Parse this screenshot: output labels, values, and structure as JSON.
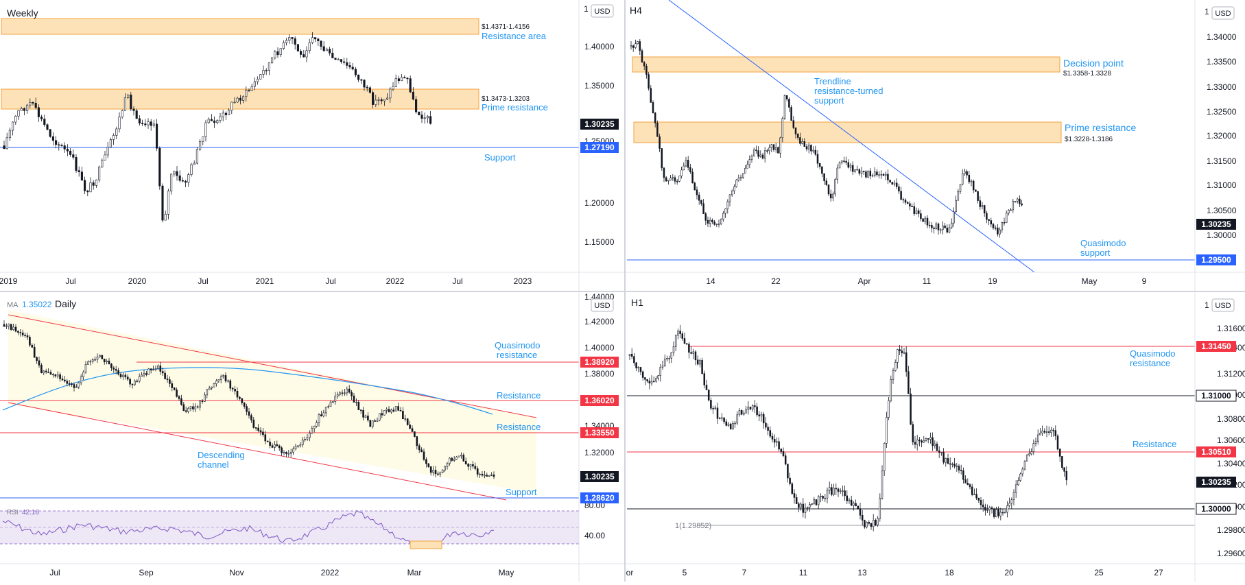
{
  "colors": {
    "zone_fill": "#fde2b8",
    "zone_stroke": "#f3a23c",
    "blue": "#2962ff",
    "blue_text": "#2196f3",
    "red": "#f23645",
    "black": "#131722",
    "grid_text": "#131722",
    "channel_fill": "#fefbe7",
    "ma_line": "#2196f3",
    "rsi_line": "#7e57c2",
    "rsi_fill": "#ede7f6"
  },
  "icons": {
    "currency_badge": "currency-badge-icon"
  },
  "panels": [
    {
      "id": "weekly",
      "title": "Weekly",
      "currency": "USD",
      "x_labels": [
        "2019",
        "Jul",
        "2020",
        "Jul",
        "2021",
        "Jul",
        "2022",
        "Jul",
        "2023"
      ],
      "y_labels": [
        "1.40000",
        "1.35000",
        "1.25000",
        "1.20000",
        "1.15000"
      ],
      "y_top_clipped": "1",
      "badges": [
        {
          "text": "1.30235",
          "style": "black"
        },
        {
          "text": "1.27190",
          "style": "blue"
        }
      ],
      "zones": [
        {
          "range": "$1.4371-1.4156",
          "label": "Resistance area"
        },
        {
          "range": "$1.3473-1.3203",
          "label": "Prime resistance"
        }
      ],
      "level_labels": [
        {
          "text": "Support"
        }
      ]
    },
    {
      "id": "h4",
      "title": "H4",
      "currency": "USD",
      "x_labels": [
        "14",
        "22",
        "Apr",
        "11",
        "19",
        "May",
        "9"
      ],
      "y_labels": [
        "1.34000",
        "1.33500",
        "1.33000",
        "1.32500",
        "1.32000",
        "1.31500",
        "1.31000",
        "1.30500",
        "1.30000"
      ],
      "y_top_clipped": "1",
      "badges": [
        {
          "text": "1.30235",
          "style": "black"
        },
        {
          "text": "1.29500",
          "style": "blue"
        }
      ],
      "zones": [
        {
          "range": "$1.3358-1.3328",
          "label": "Decision point"
        },
        {
          "range": "$1.3228-1.3186",
          "label": "Prime resistance"
        }
      ],
      "trendline_label": [
        "Trendline",
        "resistance-turned",
        "support"
      ],
      "level_label": [
        "Quasimodo",
        "support"
      ]
    },
    {
      "id": "daily",
      "title": "Daily",
      "ma_prefix": "MA",
      "ma_value": "1.35022",
      "currency": "USD",
      "x_labels": [
        "Jul",
        "Sep",
        "Nov",
        "2022",
        "Mar",
        "May"
      ],
      "y_labels": [
        "1.44000",
        "1.42000",
        "1.40000",
        "1.38000",
        "1.36000",
        "1.34000",
        "1.32000",
        "1.30000",
        "80.00",
        "40.00"
      ],
      "badges": [
        {
          "text": "1.38920",
          "style": "red"
        },
        {
          "text": "1.36020",
          "style": "red"
        },
        {
          "text": "1.33550",
          "style": "red"
        },
        {
          "text": "1.30235",
          "style": "black"
        },
        {
          "text": "1.28620",
          "style": "blue"
        }
      ],
      "labels": [
        [
          "Quasimodo",
          "resistance"
        ],
        [
          "Resistance"
        ],
        [
          "Resistance"
        ],
        [
          "Descending",
          "channel"
        ],
        [
          "Support"
        ]
      ],
      "rsi_label": "RSI",
      "rsi_value": "42.16"
    },
    {
      "id": "h1",
      "title": "H1",
      "currency": "USD",
      "x_labels": [
        "or",
        "5",
        "7",
        "11",
        "13",
        "18",
        "20",
        "25",
        "27"
      ],
      "y_labels": [
        "1.31600",
        "1.31400",
        "1.31200",
        "1.31000",
        "1.30800",
        "1.30600",
        "1.30400",
        "1.30200",
        "1.30000",
        "1.29800",
        "1.29600"
      ],
      "y_top_clipped": "1",
      "badges": [
        {
          "text": "1.31450",
          "style": "red"
        },
        {
          "text": "1.31000",
          "style": "black_outline"
        },
        {
          "text": "1.30510",
          "style": "red"
        },
        {
          "text": "1.30235",
          "style": "black"
        },
        {
          "text": "1.30000",
          "style": "black_outline"
        }
      ],
      "labels": [
        [
          "Quasimodo",
          "resistance"
        ],
        [
          "Resistance"
        ]
      ],
      "fib_label": "1(1.29852)"
    }
  ]
}
